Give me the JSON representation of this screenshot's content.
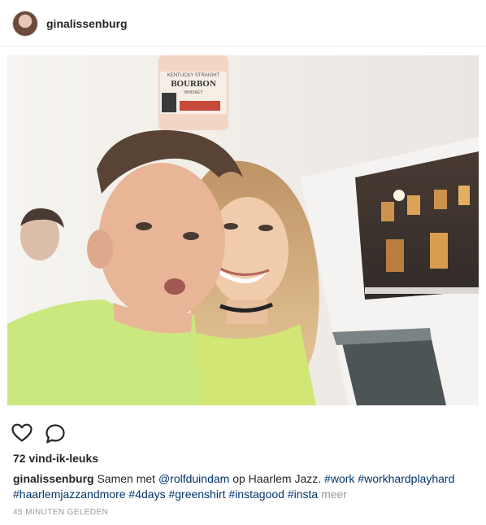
{
  "post": {
    "username": "ginalissenburg",
    "likes_text": "72 vind-ik-leuks",
    "caption": {
      "username": "ginalissenburg",
      "text_before_mention": "Samen met",
      "mention": "@rolfduindam",
      "text_after_mention": "op Haarlem Jazz.",
      "hashtags": [
        "#work",
        "#workhardplayhard",
        "#haarlemjazzandmore",
        "#4days",
        "#greenshirt",
        "#instagood",
        "#insta"
      ],
      "more_label": "meer"
    },
    "timestamp": "45 MINUTEN GELEDEN",
    "photo": {
      "bottle_label_line1": "KENTUCKY STRAIGHT",
      "bottle_label_line2": "BOURBON",
      "bottle_label_line3": "WHISKEY"
    }
  },
  "icons": {
    "avatar": "avatar",
    "like": "heart-icon",
    "comment": "comment-icon"
  }
}
